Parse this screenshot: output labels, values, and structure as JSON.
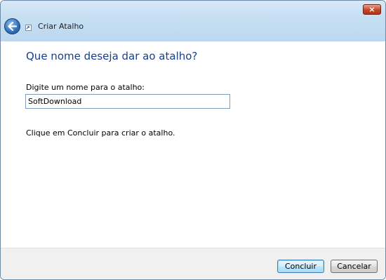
{
  "window": {
    "title": "Criar Atalho",
    "close_glyph": "×",
    "close_icon": "close-icon",
    "back_icon": "back-arrow-icon",
    "title_icon": "shortcut-icon"
  },
  "main": {
    "heading": "Que nome deseja dar ao atalho?",
    "field_label": "Digite um nome para o atalho:",
    "name_value": "SoftDownload",
    "info_text": "Clique em Concluir para criar o atalho."
  },
  "buttons": {
    "finish": "Concluir",
    "cancel": "Cancelar"
  },
  "colors": {
    "heading": "#1a3d8f",
    "frame": "#c6dff3",
    "close": "#c3452a"
  }
}
